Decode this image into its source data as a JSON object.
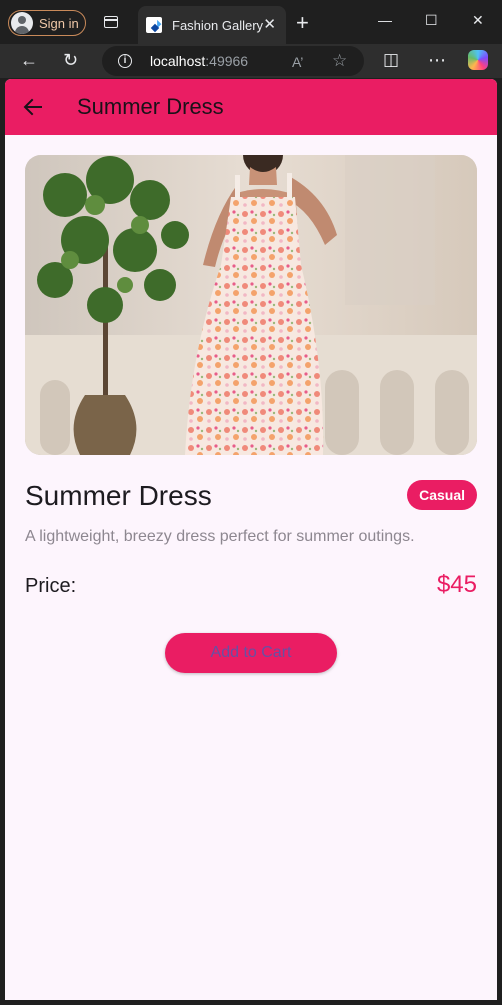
{
  "browser": {
    "signin_label": "Sign in",
    "tab_title": "Fashion Gallery",
    "tab_close": "✕",
    "new_tab": "+",
    "url_host": "localhost",
    "url_port": ":49966",
    "window_controls": {
      "minimize": "—",
      "maximize": "☐",
      "close": "✕"
    },
    "icons": {
      "back": "←",
      "refresh": "↻",
      "read_aloud": "A’",
      "favorite": "☆",
      "split": "◫",
      "more": "⋯"
    }
  },
  "app": {
    "appbar_title": "Summer Dress",
    "accent_color": "#ea1d63",
    "product": {
      "name": "Summer Dress",
      "category": "Casual",
      "description": "A lightweight, breezy dress perfect for summer outings.",
      "price_label": "Price:",
      "price": "$45",
      "add_to_cart_label": "Add to Cart"
    }
  }
}
